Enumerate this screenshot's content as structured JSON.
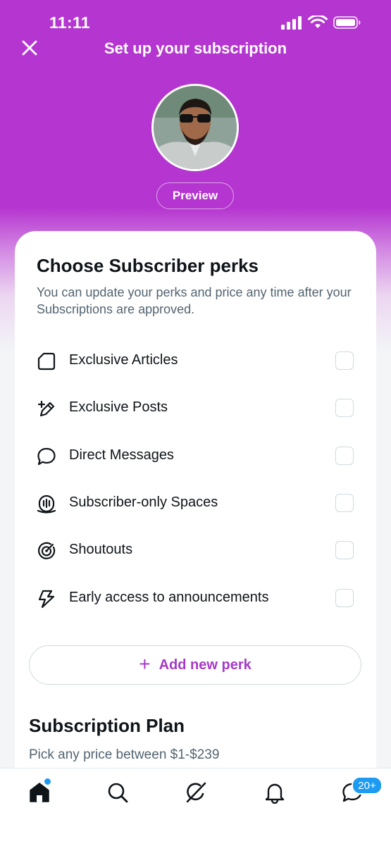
{
  "status_bar": {
    "time": "11:11"
  },
  "header": {
    "title": "Set up your subscription"
  },
  "profile": {
    "preview_label": "Preview"
  },
  "perks_section": {
    "title": "Choose Subscriber perks",
    "description": "You can update your perks and price any time after your Subscriptions are approved.",
    "items": [
      {
        "label": "Exclusive Articles",
        "icon": "article-icon",
        "checked": false
      },
      {
        "label": "Exclusive Posts",
        "icon": "pen-plus-icon",
        "checked": false
      },
      {
        "label": "Direct Messages",
        "icon": "message-bubble-icon",
        "checked": false
      },
      {
        "label": "Subscriber-only Spaces",
        "icon": "spaces-icon",
        "checked": false
      },
      {
        "label": "Shoutouts",
        "icon": "target-icon",
        "checked": false
      },
      {
        "label": "Early access to announcements",
        "icon": "lightning-icon",
        "checked": false
      }
    ],
    "add_perk_label": "Add new perk"
  },
  "plan_section": {
    "title": "Subscription Plan",
    "description": "Pick any price between $1-$239"
  },
  "tabbar": {
    "items": [
      "home-icon",
      "search-icon",
      "grok-icon",
      "bell-icon",
      "messages-icon"
    ],
    "messages_badge": "20+"
  },
  "colors": {
    "header_purple": "#b535d0",
    "accent_purple": "#a63ac8",
    "badge_blue": "#1d9bf0"
  }
}
